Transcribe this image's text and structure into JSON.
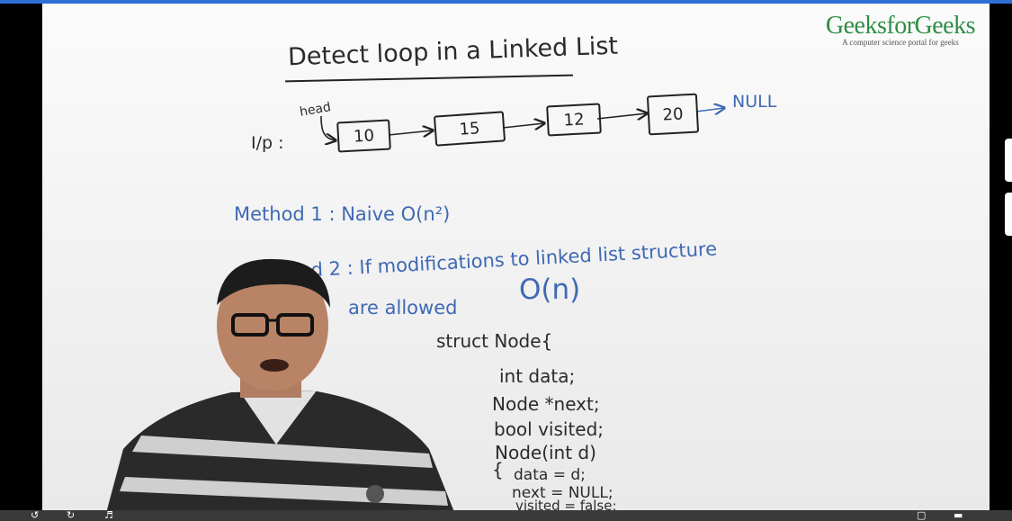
{
  "brand": {
    "name": "GeeksforGeeks",
    "tagline": "A computer science portal for geeks"
  },
  "board": {
    "title": "Detect loop in a Linked List",
    "input_label": "I/p :",
    "head_label": "head",
    "nodes": [
      "10",
      "15",
      "12",
      "20"
    ],
    "null_label": "NULL",
    "method1": "Method 1 : Naive O(n²)",
    "method2_line1": "Method 2 :  If modifications to linked list structure",
    "method2_line2": "are allowed",
    "method2_complexity": "O(n)",
    "code": [
      "struct Node{",
      "int data;",
      "Node *next;",
      "bool visited;",
      "Node(int d)",
      "{",
      "data = d;",
      "next = NULL;",
      "visited = false;"
    ]
  },
  "player": {
    "icons": [
      "rewind-icon",
      "forward-icon",
      "volume-icon",
      "subtitles-icon",
      "settings-icon"
    ]
  },
  "colors": {
    "brand": "#2f8d46",
    "marker_blue": "#3f69b4",
    "marker_black": "#222222"
  }
}
